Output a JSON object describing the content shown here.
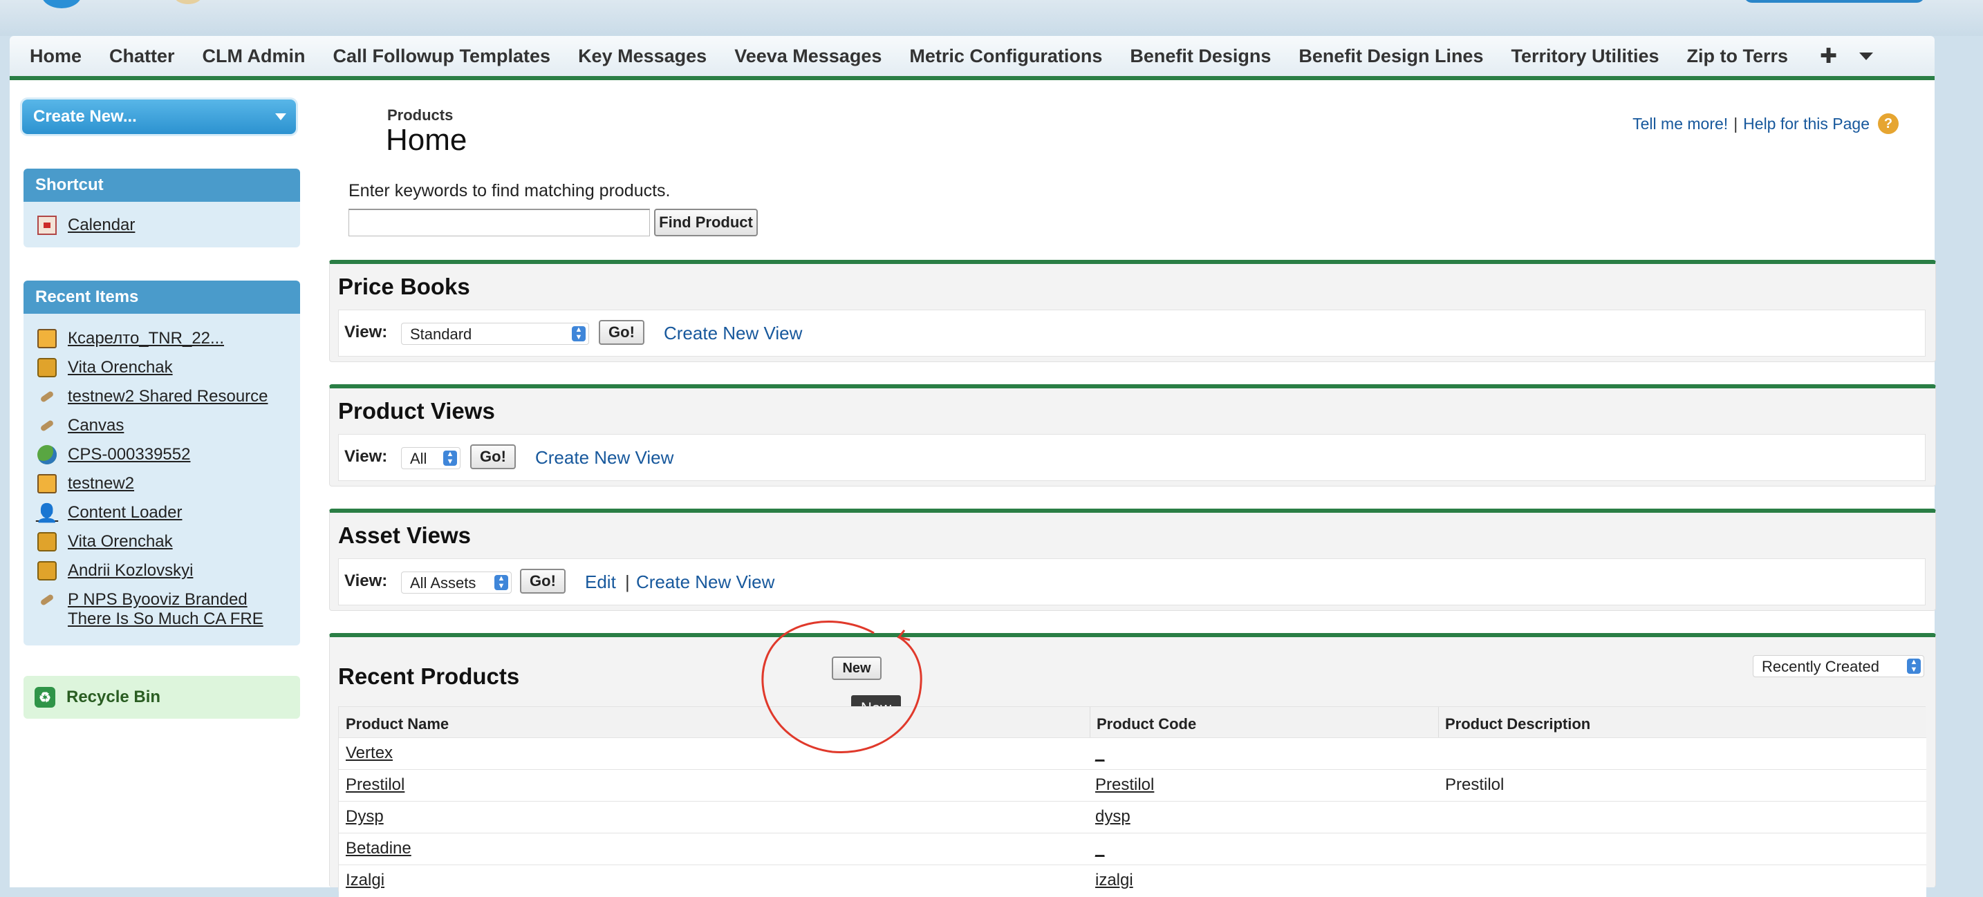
{
  "nav": {
    "tabs": [
      "Home",
      "Chatter",
      "CLM Admin",
      "Call Followup Templates",
      "Key Messages",
      "Veeva Messages",
      "Metric Configurations",
      "Benefit Designs",
      "Benefit Design Lines",
      "Territory Utilities",
      "Zip to Terrs"
    ],
    "add_icon": "plus-icon",
    "more_icon": "chevron-down-icon"
  },
  "sidebar": {
    "create_new": "Create New...",
    "shortcut_title": "Shortcut",
    "shortcut_items": [
      {
        "label": "Calendar",
        "icon": "calendar-icon"
      }
    ],
    "recent_title": "Recent Items",
    "recent_items": [
      {
        "label": "Ксарелто_TNR_22...",
        "icon": "product-icon"
      },
      {
        "label": "Vita Orenchak",
        "icon": "resource-icon"
      },
      {
        "label": "testnew2 Shared Resource",
        "icon": "link-icon"
      },
      {
        "label": "Canvas",
        "icon": "link-icon"
      },
      {
        "label": "CPS-000339552",
        "icon": "globe-icon"
      },
      {
        "label": "testnew2",
        "icon": "product-icon"
      },
      {
        "label": "Content Loader",
        "icon": "user-icon"
      },
      {
        "label": "Vita Orenchak",
        "icon": "resource-icon"
      },
      {
        "label": "Andrii Kozlovskyi",
        "icon": "resource-icon"
      },
      {
        "label": "P NPS Byooviz Branded There Is So Much CA FRE",
        "icon": "link-icon"
      }
    ],
    "recycle_bin": "Recycle Bin"
  },
  "header": {
    "object": "Products",
    "title": "Home",
    "tell_me_more": "Tell me more!",
    "separator": "|",
    "help_link": "Help for this Page",
    "help_icon": "?"
  },
  "search": {
    "hint": "Enter keywords to find matching products.",
    "value": "",
    "button": "Find Product"
  },
  "sections": {
    "price_books": {
      "title": "Price Books",
      "view_label": "View:",
      "selected": "Standard",
      "go": "Go!",
      "create_view": "Create New View"
    },
    "product_views": {
      "title": "Product Views",
      "view_label": "View:",
      "selected": "All",
      "go": "Go!",
      "create_view": "Create New View"
    },
    "asset_views": {
      "title": "Asset Views",
      "view_label": "View:",
      "selected": "All Assets",
      "go": "Go!",
      "edit": "Edit",
      "separator": "|",
      "create_view": "Create New View"
    }
  },
  "recent_products": {
    "title": "Recent Products",
    "new_button": "New",
    "tooltip": "New",
    "sort_select": "Recently Created",
    "columns": [
      "Product Name",
      "Product Code",
      "Product Description"
    ],
    "rows": [
      {
        "name": "Vertex",
        "code": "_",
        "description": ""
      },
      {
        "name": "Prestilol",
        "code": "Prestilol",
        "description": "Prestilol"
      },
      {
        "name": "Dysp",
        "code": "dysp",
        "description": ""
      },
      {
        "name": "Betadine",
        "code": "_",
        "description": ""
      },
      {
        "name": "Izalgi",
        "code": "izalgi",
        "description": ""
      }
    ]
  },
  "colors": {
    "tab_underline": "#2a7e45",
    "link": "#17589c",
    "annotation": "#e0392b",
    "sidebar_header": "#4a9bcb"
  }
}
